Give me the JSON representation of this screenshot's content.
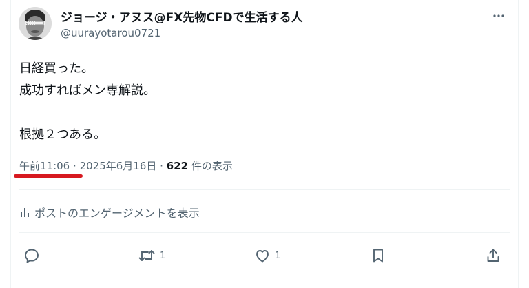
{
  "user": {
    "display_name": "ジョージ・アヌス@FX先物CFDで生活する人",
    "handle": "@uurayotarou0721"
  },
  "tweet": {
    "lines": [
      "日経買った。",
      "成功すればメン専解説。",
      "",
      "根拠２つある。"
    ],
    "time": "午前11:06",
    "separator": "·",
    "date": "2025年6月16日",
    "views_count": "622",
    "views_label": "件の表示"
  },
  "analytics": {
    "label": "ポストのエンゲージメントを表示"
  },
  "actions": {
    "reply_count": "",
    "retweet_count": "1",
    "like_count": "1"
  },
  "colors": {
    "text": "#0f1419",
    "muted": "#536471",
    "underline": "#d71920"
  }
}
